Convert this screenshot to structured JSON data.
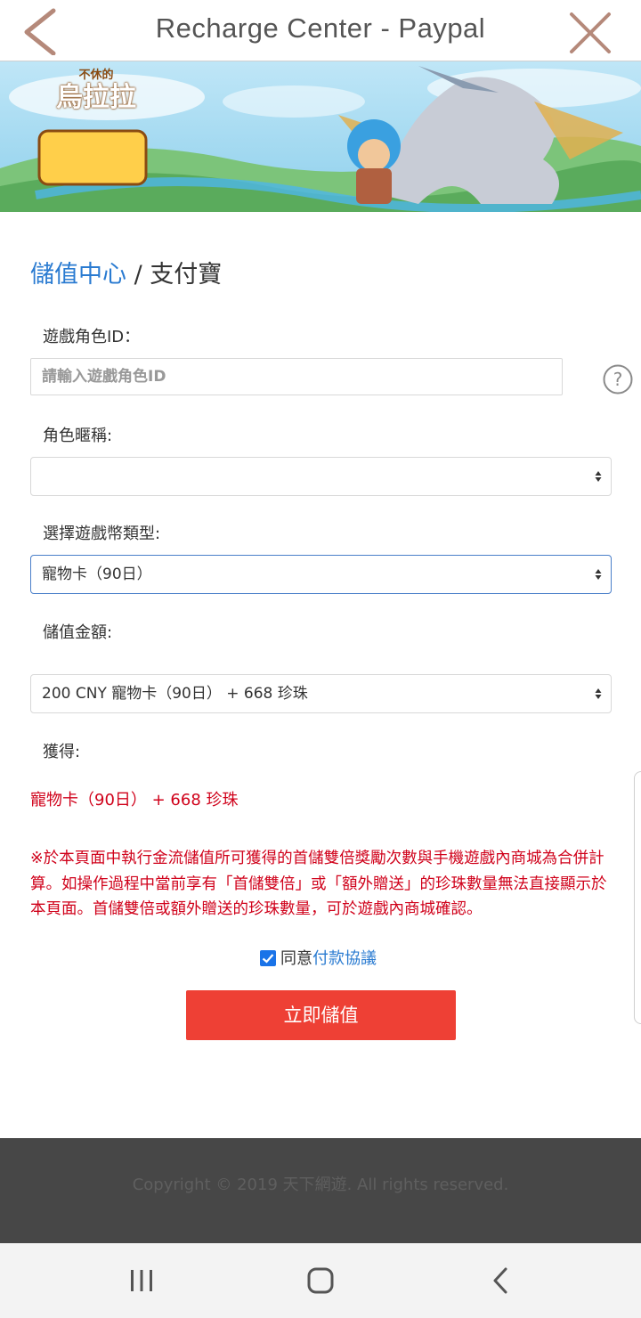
{
  "topbar": {
    "title": "Recharge Center - Paypal",
    "back_icon": "chevron-left-icon",
    "close_icon": "close-icon"
  },
  "banner": {
    "logo_top": "不休的",
    "logo_main": "烏拉拉"
  },
  "heading": {
    "link": "儲值中心",
    "separator": "/",
    "current": "支付寶"
  },
  "form": {
    "role_id_label": "遊戲角色ID：",
    "role_id_placeholder": "請輸入遊戲角色ID",
    "role_id_value": "",
    "nickname_label": "角色暱稱:",
    "nickname_value": "",
    "currency_label": "選擇遊戲幣類型:",
    "currency_value": "寵物卡（90日）",
    "amount_label": "儲值金額:",
    "amount_value": "200 CNY 寵物卡（90日） + 668 珍珠",
    "obtain_label": "獲得:",
    "obtain_value": "寵物卡（90日） + 668 珍珠"
  },
  "notice": "※於本頁面中執行金流儲值所可獲得的首儲雙倍獎勵次數與手機遊戲內商城為合併計算。如操作過程中當前享有「首儲雙倍」或「額外贈送」的珍珠數量無法直接顯示於本頁面。首儲雙倍或額外贈送的珍珠數量，可於遊戲內商城確認。",
  "agree": {
    "checked": true,
    "prefix": "同意",
    "link": "付款協議"
  },
  "submit_label": "立即儲值",
  "footer": {
    "copyright": "Copyright © 2019 天下網遊. All rights reserved."
  },
  "colors": {
    "accent_blue": "#2a7bd1",
    "warning_red": "#d0021b",
    "button_red": "#ee4035",
    "footer_bg": "#474747"
  }
}
